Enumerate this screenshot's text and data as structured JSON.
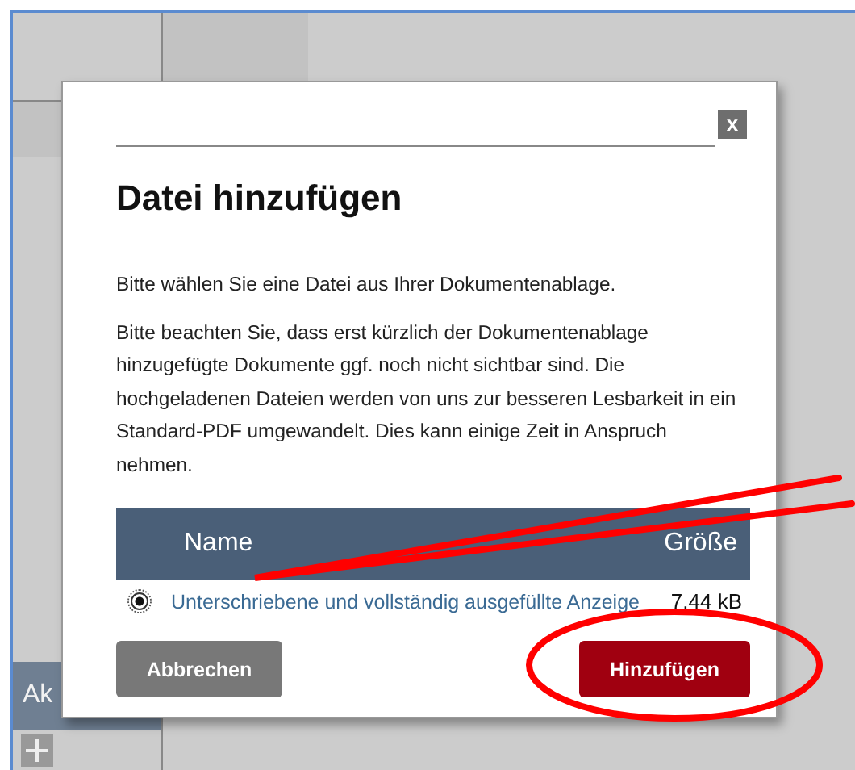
{
  "background": {
    "panel_label": "Ak"
  },
  "dialog": {
    "close_label": "x",
    "title": "Datei hinzufügen",
    "paragraphs": [
      "Bitte wählen Sie eine Datei aus Ihrer Dokumentenablage.",
      "Bitte beachten Sie, dass erst kürzlich der Dokumentenablage hinzugefügte Dokumente ggf. noch nicht sichtbar sind. Die hochgeladenen Dateien werden von uns zur besseren Lesbarkeit in ein Standard-PDF umgewandelt. Dies kann einige Zeit in Anspruch nehmen."
    ],
    "table": {
      "columns": [
        "Name",
        "Größe"
      ],
      "rows": [
        {
          "selected": true,
          "name": "Unterschriebene und vollständig ausgefüllte Anzeige",
          "size": "7.44 kB"
        }
      ]
    },
    "buttons": [
      {
        "kind": "secondary",
        "label": "Abbrechen"
      },
      {
        "kind": "primary",
        "label": "Hinzufügen"
      }
    ]
  }
}
